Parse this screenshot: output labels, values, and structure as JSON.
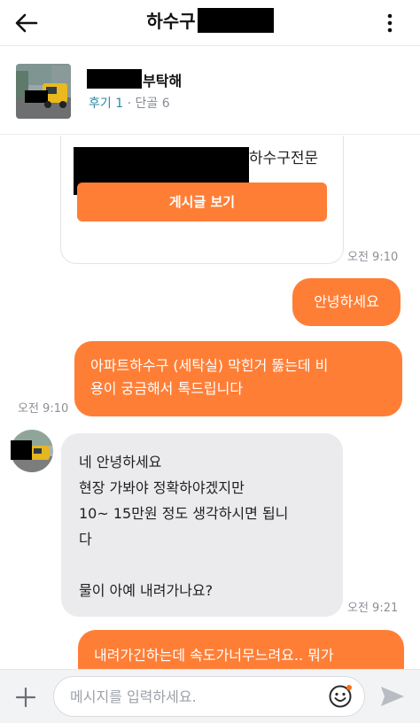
{
  "header": {
    "title": "하수구",
    "back_icon": "arrow-left-icon",
    "more_icon": "more-vertical-icon"
  },
  "post": {
    "title_suffix": "부탁해",
    "reviews": "후기 1",
    "separator": "·",
    "regulars": "단골 6"
  },
  "card": {
    "text": "하수구전문",
    "button_label": "게시글 보기",
    "time": "오전 9:10"
  },
  "messages": [
    {
      "side": "out",
      "lines": [
        "안녕하세요"
      ]
    },
    {
      "side": "out",
      "lines": [
        "아파트하수구 (세탁실) 막힌거 뚫는데 비",
        "용이 궁금해서 톡드립니다"
      ],
      "time": "오전 9:10"
    },
    {
      "side": "in",
      "lines": [
        "네 안녕하세요",
        "현장 가봐야 정확하야겠지만",
        "10~ 15만원 정도 생각하시면 됩니",
        "다",
        "",
        "물이 아예 내려가나요?"
      ],
      "time": "오전 9:21"
    },
    {
      "side": "out",
      "lines": [
        "내려가긴하는데 속도가너무느려요.. 뭐가"
      ]
    }
  ],
  "composer": {
    "placeholder": "메시지를 입력하세요.",
    "plus_icon": "plus-icon",
    "emoji_icon": "emoji-icon",
    "send_icon": "send-icon"
  },
  "colors": {
    "accent": "#ff7e36",
    "incoming_bubble": "#ebebee",
    "review_link": "#2c8aa5"
  }
}
